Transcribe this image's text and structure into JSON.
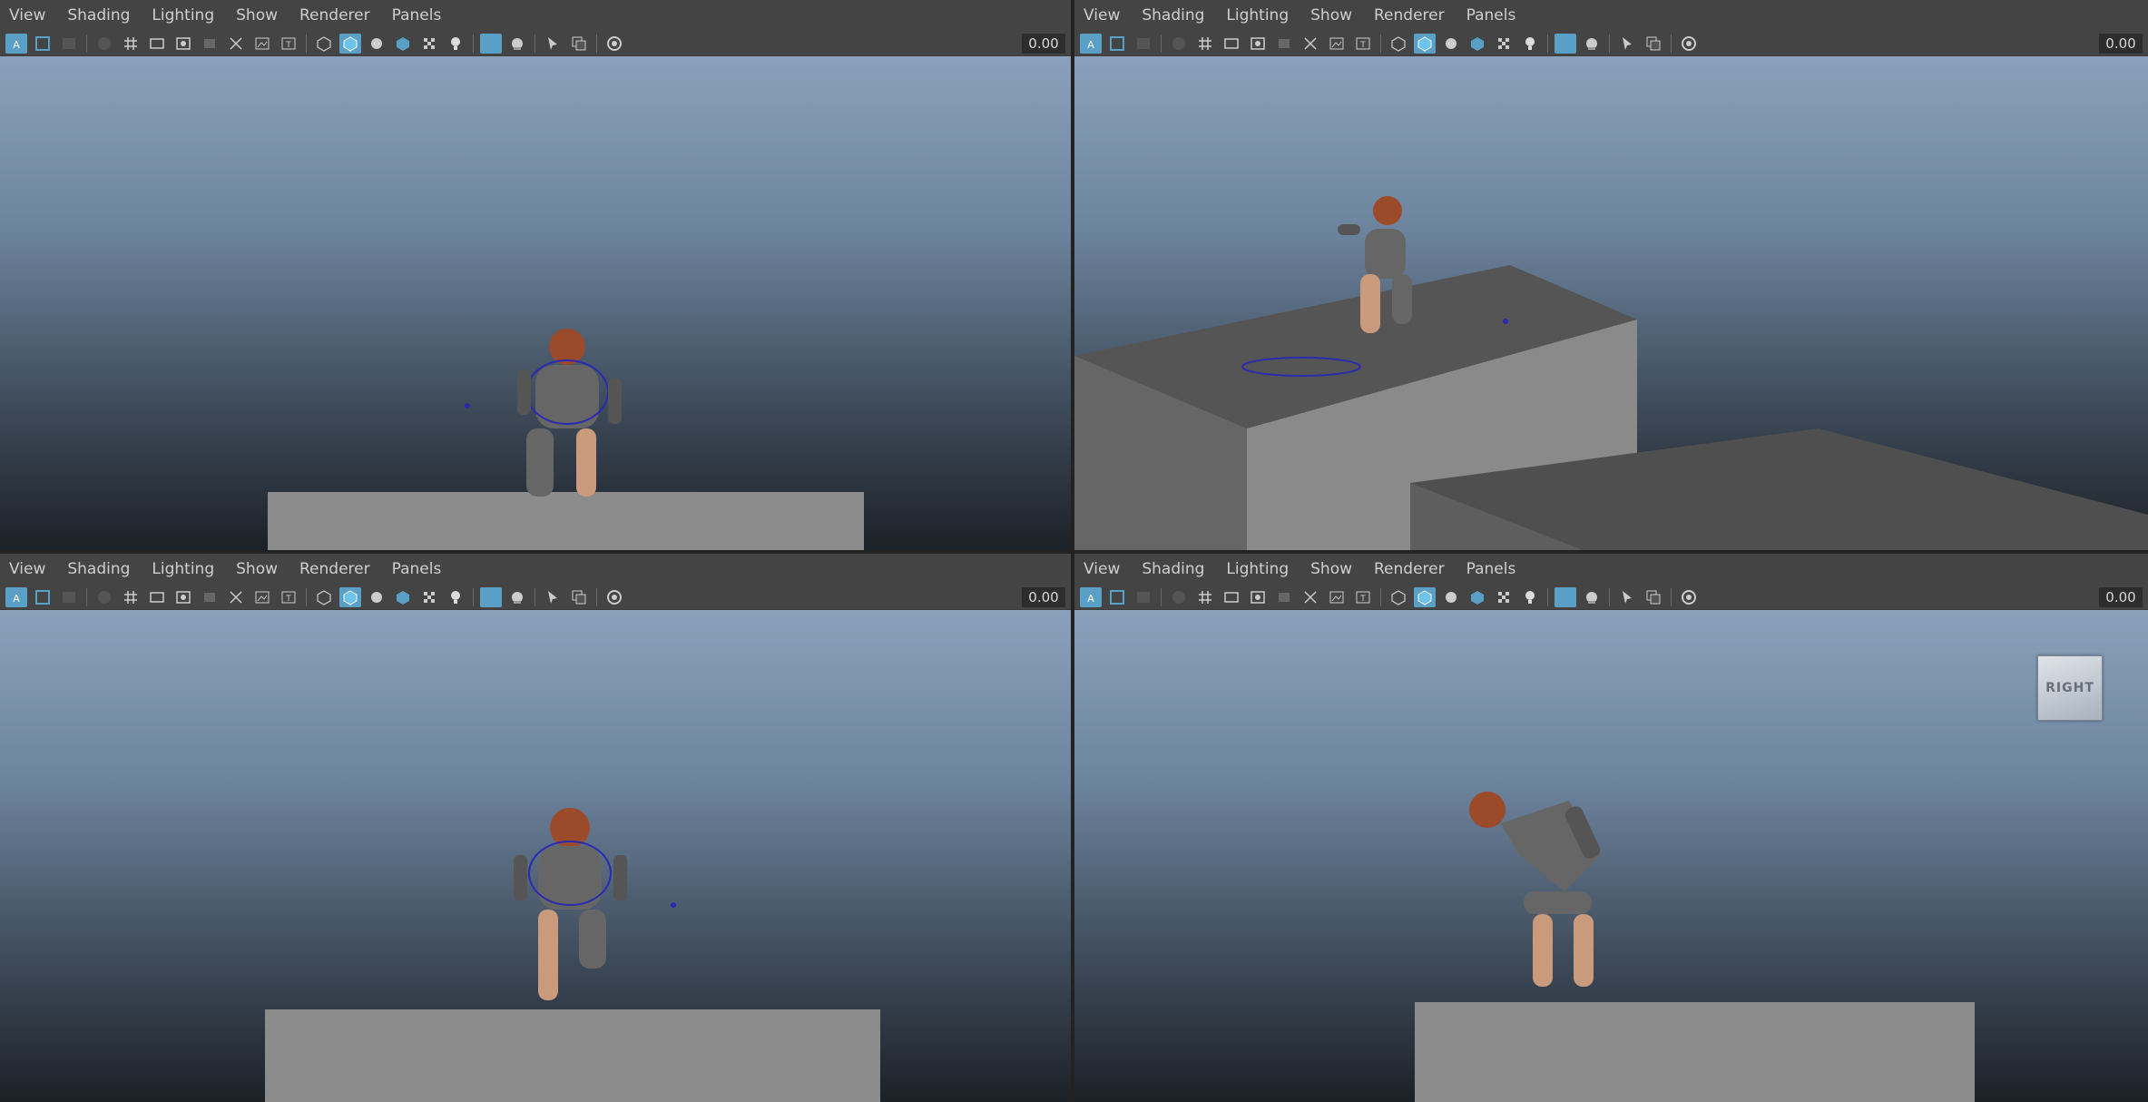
{
  "menu": [
    "View",
    "Shading",
    "Lighting",
    "Show",
    "Renderer",
    "Panels"
  ],
  "toolbar_value": "0.00",
  "viewcube_label": "RIGHT",
  "icons": [
    "select-camera-icon",
    "camera-attributes-icon",
    "bookmarks-icon",
    "image-plane-icon",
    "grid-icon",
    "film-gate-icon",
    "resolution-gate-icon",
    "gate-mask-icon",
    "field-chart-icon",
    "safe-action-icon",
    "safe-title-icon",
    "wireframe-icon",
    "smooth-shade-icon",
    "default-material-icon",
    "textured-icon",
    "shadows-icon",
    "lights-icon",
    "xray-icon",
    "isolate-icon",
    "select-tool-icon",
    "frame-selection-icon",
    "exposure-icon"
  ],
  "panels": [
    {
      "id": "persp-top-left"
    },
    {
      "id": "persp-top-right"
    },
    {
      "id": "front-bottom-left"
    },
    {
      "id": "side-bottom-right"
    }
  ]
}
